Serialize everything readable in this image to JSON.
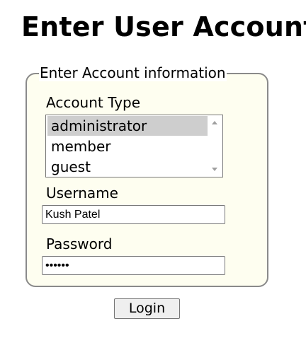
{
  "page": {
    "title": "Enter User Account"
  },
  "form": {
    "legend": "Enter Account information",
    "account_type": {
      "label": "Account Type",
      "options": [
        "administrator",
        "member",
        "guest"
      ],
      "selected": "administrator"
    },
    "username": {
      "label": "Username",
      "value": "Kush Patel"
    },
    "password": {
      "label": "Password",
      "value": "••••••"
    },
    "submit_label": "Login"
  },
  "colors": {
    "fieldset_background": "#fefef0",
    "fieldset_border": "#8a8a8a",
    "selected_option": "#cecece",
    "button_background": "#efefef"
  }
}
